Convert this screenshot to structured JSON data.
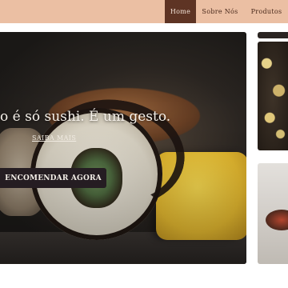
{
  "nav": {
    "items": [
      {
        "label": "Home",
        "active": true
      },
      {
        "label": "Sobre Nós",
        "active": false
      },
      {
        "label": "Produtos",
        "active": false
      }
    ]
  },
  "hero": {
    "title": "o é só sushi. É um gesto.",
    "link_label": "SAIBA MAIS",
    "button_label": "ENCOMENDAR AGORA"
  },
  "colors": {
    "topbar": "#ebbfa3",
    "nav_active": "#5e3424",
    "button": "#251d22"
  }
}
